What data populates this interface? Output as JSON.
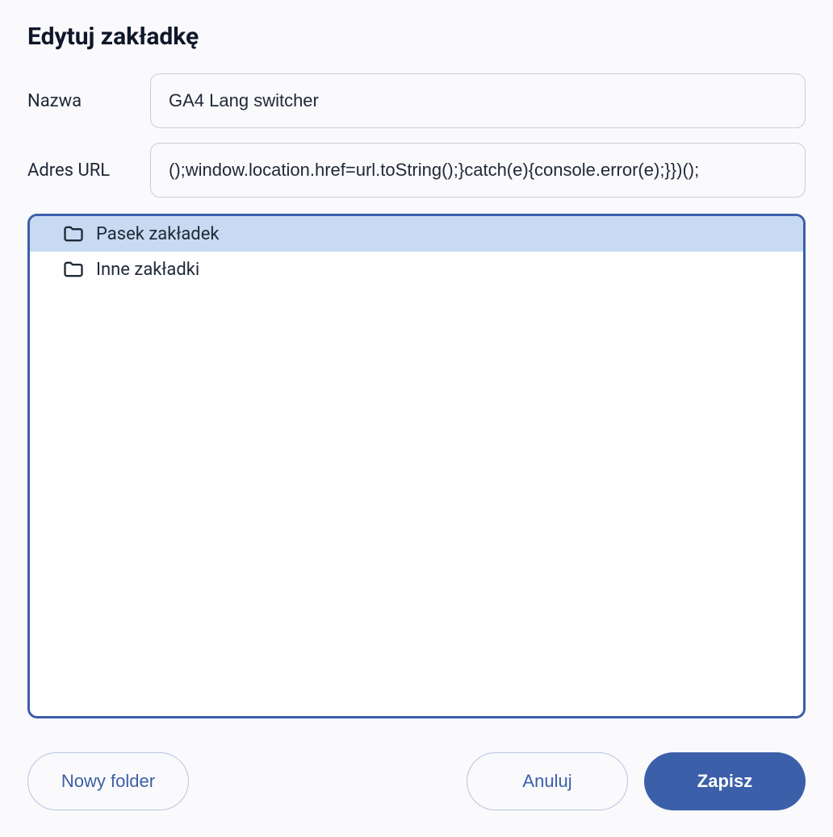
{
  "dialog": {
    "title": "Edytuj zakładkę"
  },
  "fields": {
    "name_label": "Nazwa",
    "name_value": "GA4 Lang switcher",
    "url_label": "Adres URL",
    "url_value": "();window.location.href=url.toString();}catch(e){console.error(e);}})();"
  },
  "folders": {
    "items": [
      {
        "label": "Pasek zakładek",
        "selected": true
      },
      {
        "label": "Inne zakładki",
        "selected": false
      }
    ]
  },
  "buttons": {
    "new_folder": "Nowy folder",
    "cancel": "Anuluj",
    "save": "Zapisz"
  }
}
